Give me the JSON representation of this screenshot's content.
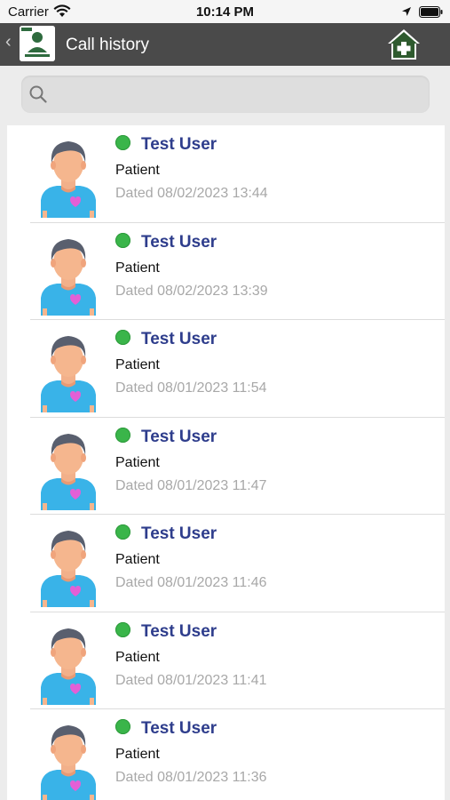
{
  "status": {
    "carrier": "Carrier",
    "time": "10:14 PM"
  },
  "nav": {
    "title": "Call history"
  },
  "search": {
    "placeholder": ""
  },
  "calls": [
    {
      "name": "Test User",
      "role": "Patient",
      "date": "Dated 08/02/2023 13:44"
    },
    {
      "name": "Test User",
      "role": "Patient",
      "date": "Dated 08/02/2023 13:39"
    },
    {
      "name": "Test User",
      "role": "Patient",
      "date": "Dated 08/01/2023 11:54"
    },
    {
      "name": "Test User",
      "role": "Patient",
      "date": "Dated 08/01/2023 11:47"
    },
    {
      "name": "Test User",
      "role": "Patient",
      "date": "Dated 08/01/2023 11:46"
    },
    {
      "name": "Test User",
      "role": "Patient",
      "date": "Dated 08/01/2023 11:41"
    },
    {
      "name": "Test User",
      "role": "Patient",
      "date": "Dated 08/01/2023 11:36"
    }
  ],
  "colors": {
    "nav_bg": "#4a4a4a",
    "online": "#3ab54a",
    "name": "#2e3d8c",
    "date": "#a8a8a8"
  },
  "icons": [
    "wifi-icon",
    "location-icon",
    "battery-icon",
    "back-chevron-icon",
    "home-plus-icon",
    "search-icon",
    "online-status-icon",
    "user-avatar-icon"
  ]
}
